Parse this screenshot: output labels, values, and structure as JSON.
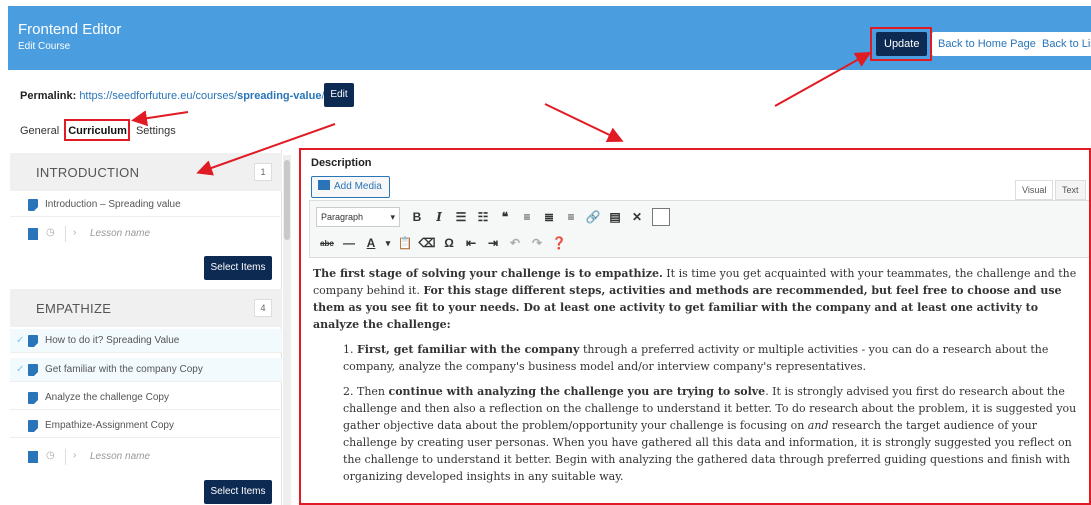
{
  "header": {
    "title": "Frontend Editor",
    "subtitle": "Edit Course",
    "update_label": "Update",
    "home_label": "Back to Home Page",
    "list_label": "Back to List"
  },
  "permalink": {
    "label": "Permalink:",
    "url": "https://seedforfuture.eu/courses/",
    "slug": "spreading-value",
    "slash": "/",
    "edit_label": "Edit"
  },
  "tabs": [
    "General",
    "Curriculum",
    "Settings"
  ],
  "sections": [
    {
      "name": "INTRODUCTION",
      "count": "1",
      "items": [
        {
          "label": "Introduction – Spreading value",
          "done": false
        }
      ]
    },
    {
      "name": "EMPATHIZE",
      "count": "4",
      "items": [
        {
          "label": "How to do it? Spreading Value",
          "done": true
        },
        {
          "label": "Get familiar with the company Copy",
          "done": true
        },
        {
          "label": "Analyze the challenge Copy",
          "done": false
        },
        {
          "label": "Empathize-Assignment Copy",
          "done": false
        }
      ]
    }
  ],
  "lesson_placeholder": "Lesson name",
  "select_items_label": "Select Items",
  "editor": {
    "label": "Description",
    "add_media": "Add Media",
    "tab_visual": "Visual",
    "tab_text": "Text",
    "format": "Paragraph",
    "intro_bold_1": "The first stage of solving your challenge is to empathize.",
    "intro_1": " It is time you get acquainted with your teammates, the challenge and the company behind it. ",
    "intro_bold_2": "For this stage different steps, activities and methods are recommended, but feel free to choose and use them as you see fit to your needs. Do at least one activity to get familiar with the company and at least one activity to analyze the challenge:",
    "p1_num": "1. ",
    "p1_bold": "First, get familiar with the company",
    "p1_text": " through a preferred activity or multiple activities - you can do a research about the company, analyze the company's business model and/or interview company's representatives.",
    "p2_num": "2. Then ",
    "p2_bold": "continue with analyzing the challenge you are trying to solve",
    "p2_text_a": ". It is strongly advised you first do research about the challenge and then also a reflection on the challenge to understand it better. To do research about the problem, it is suggested you gather objective data about the problem/opportunity your challenge is focusing on ",
    "p2_em": "and",
    "p2_text_b": " research the target audience of your challenge by creating user personas. When you have gathered all this data and information, it is strongly suggested you reflect on the challenge to understand it better. Begin with analyzing the gathered data through preferred guiding questions and finish with organizing developed insights in any suitable way."
  },
  "colors": {
    "header": "#4a9ee0",
    "dark_button": "#0d2a52",
    "highlight": "#e01b24",
    "link": "#2a75b9"
  }
}
